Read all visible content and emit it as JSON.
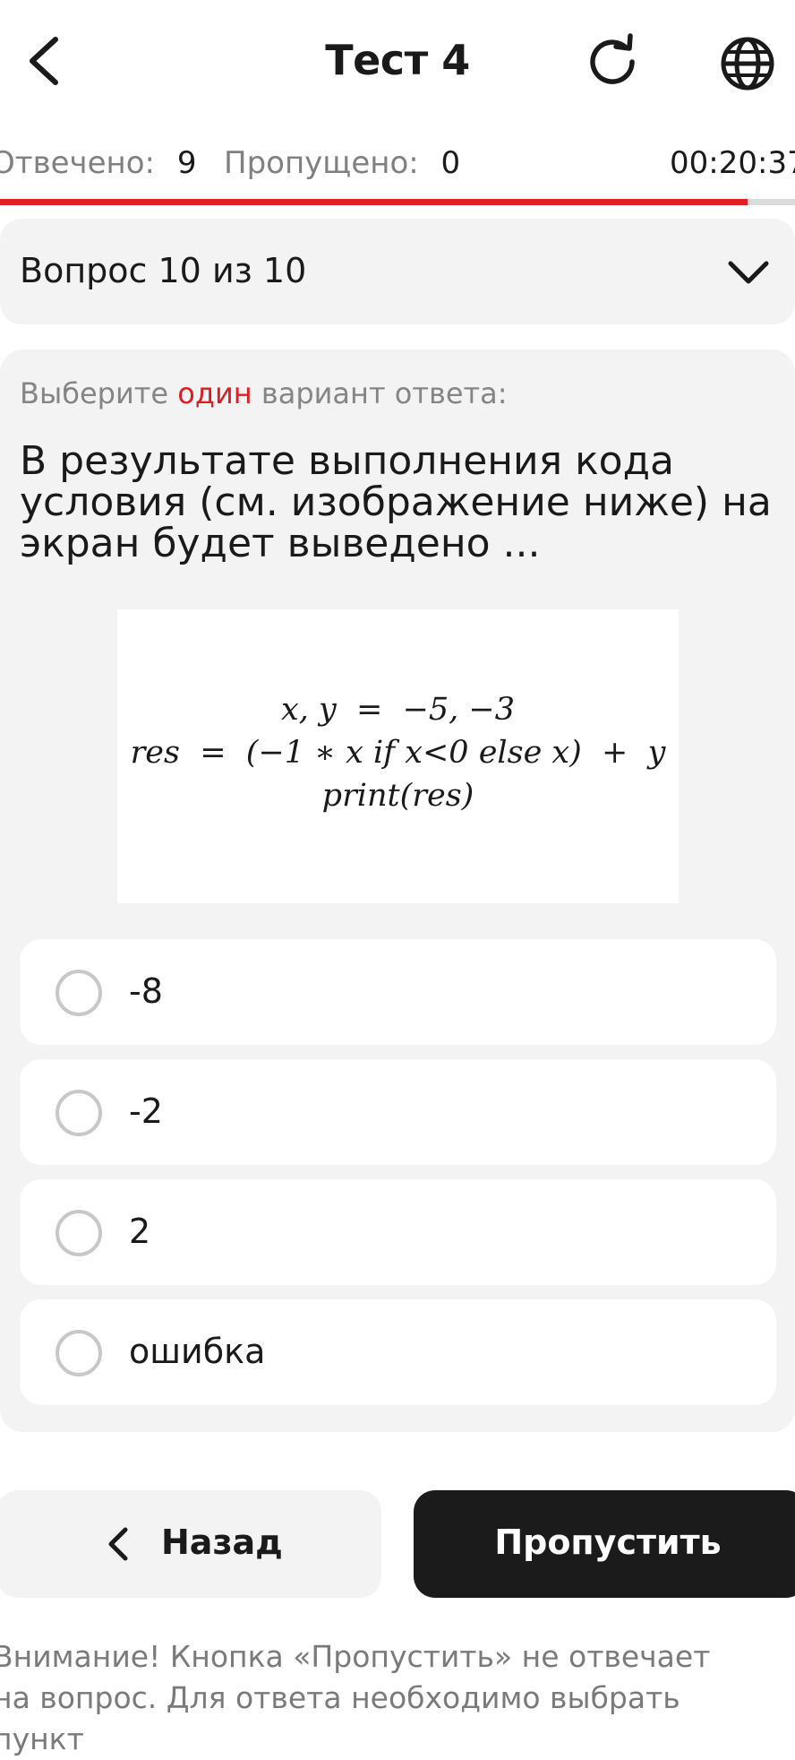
{
  "header": {
    "title": "Тест 4"
  },
  "stats": {
    "answered_label": "Отвечено:",
    "answered_value": "9",
    "skipped_label": "Пропущено:",
    "skipped_value": "0",
    "timer": "00:20:37",
    "progress_fraction": 0.94
  },
  "question_selector": {
    "label": "Вопрос 10 из 10"
  },
  "question": {
    "instruction_before": "Выберите ",
    "instruction_accent": "один",
    "instruction_after": " вариант ответа:",
    "text": "В результате выполнения кода условия (см. изображение ниже) на экран будет выведено ...",
    "code_lines": [
      "x, y  =  −5, −3",
      "res  =  (−1 ∗ x if x<0 else x)  +  y",
      "print(res)"
    ]
  },
  "options": [
    {
      "label": "-8"
    },
    {
      "label": "-2"
    },
    {
      "label": "2"
    },
    {
      "label": "ошибка"
    }
  ],
  "buttons": {
    "back_label": "Назад",
    "skip_label": "Пропустить"
  },
  "notice": {
    "line1": "Внимание! Кнопка «Пропустить» не отвечает",
    "line2": "на вопрос. Для ответа необходимо выбрать пункт"
  },
  "colors": {
    "accent": "#e31e24",
    "dark_button": "#1b1b1b",
    "card_bg": "#f3f3f3"
  }
}
